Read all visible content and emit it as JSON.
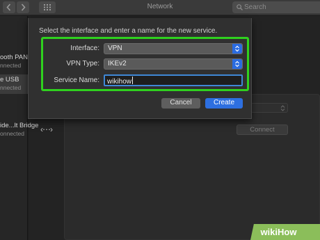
{
  "window": {
    "title": "Network",
    "back_icon": "chevron-left-icon",
    "forward_icon": "chevron-right-icon",
    "search_placeholder": "Search"
  },
  "sidebar": {
    "items": [
      {
        "name": "ooth PAN",
        "status": "nnected"
      },
      {
        "name": "e USB",
        "status": "nnected"
      },
      {
        "name": "ide...lt Bridge",
        "status": "onnected"
      }
    ]
  },
  "background_panel": {
    "connect_label": "Connect"
  },
  "dialog": {
    "prompt": "Select the interface and enter a name for the new service.",
    "interface_label": "Interface:",
    "interface_value": "VPN",
    "vpn_type_label": "VPN Type:",
    "vpn_type_value": "IKEv2",
    "service_name_label": "Service Name:",
    "service_name_value": "wikihow",
    "cancel_label": "Cancel",
    "create_label": "Create",
    "highlight_color": "#2fd11e",
    "accent_color": "#2d6fe0"
  },
  "watermark": {
    "text": "wikiHow"
  }
}
